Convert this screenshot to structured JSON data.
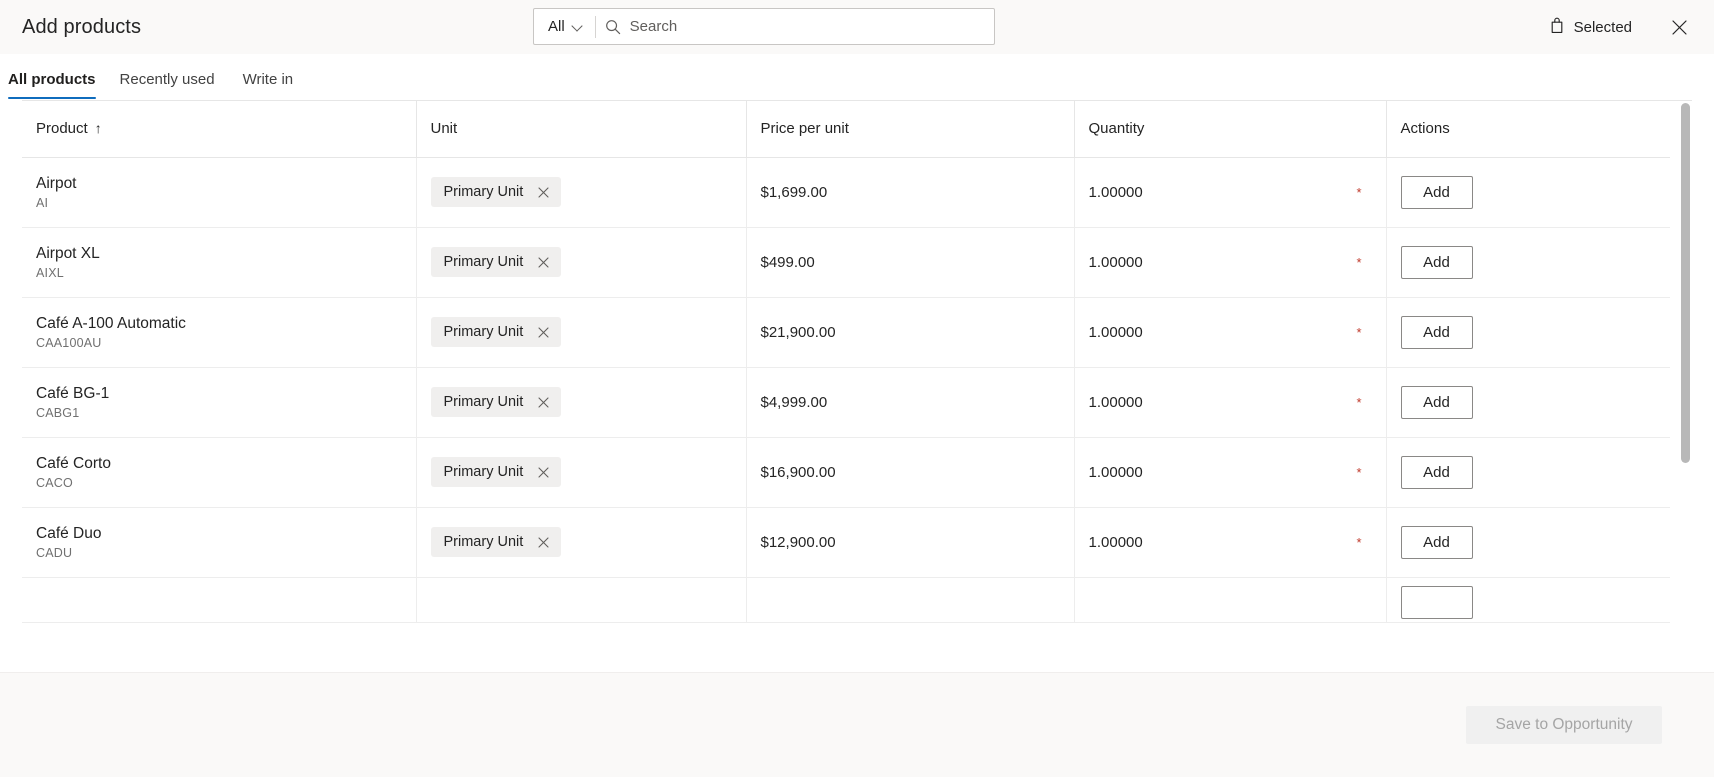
{
  "header": {
    "title": "Add products",
    "search": {
      "scope_label": "All",
      "placeholder": "Search",
      "value": ""
    },
    "selected_label": "Selected",
    "close_label": "Close"
  },
  "tabs": [
    {
      "label": "All products",
      "active": true
    },
    {
      "label": "Recently used",
      "active": false
    },
    {
      "label": "Write in",
      "active": false
    }
  ],
  "table": {
    "columns": [
      {
        "label": "Product",
        "sort": "↑"
      },
      {
        "label": "Unit",
        "sort": ""
      },
      {
        "label": "Price per unit",
        "sort": ""
      },
      {
        "label": "Quantity",
        "sort": ""
      },
      {
        "label": "Actions",
        "sort": ""
      }
    ],
    "rows": [
      {
        "product": "Airpot",
        "code": "AI",
        "unit": "Primary Unit",
        "price": "$1,699.00",
        "quantity": "1.00000",
        "required": "*",
        "action": "Add"
      },
      {
        "product": "Airpot XL",
        "code": "AIXL",
        "unit": "Primary Unit",
        "price": "$499.00",
        "quantity": "1.00000",
        "required": "*",
        "action": "Add"
      },
      {
        "product": "Café A-100 Automatic",
        "code": "CAA100AU",
        "unit": "Primary Unit",
        "price": "$21,900.00",
        "quantity": "1.00000",
        "required": "*",
        "action": "Add"
      },
      {
        "product": "Café BG-1",
        "code": "CABG1",
        "unit": "Primary Unit",
        "price": "$4,999.00",
        "quantity": "1.00000",
        "required": "*",
        "action": "Add"
      },
      {
        "product": "Café Corto",
        "code": "CACO",
        "unit": "Primary Unit",
        "price": "$16,900.00",
        "quantity": "1.00000",
        "required": "*",
        "action": "Add"
      },
      {
        "product": "Café Duo",
        "code": "CADU",
        "unit": "Primary Unit",
        "price": "$12,900.00",
        "quantity": "1.00000",
        "required": "*",
        "action": "Add"
      }
    ]
  },
  "footer": {
    "save_label": "Save to Opportunity",
    "save_disabled": true
  },
  "colors": {
    "accent": "#0f6cbd",
    "required": "#c0392b",
    "header_bg": "#faf9f8",
    "chip_bg": "#f0efee"
  }
}
